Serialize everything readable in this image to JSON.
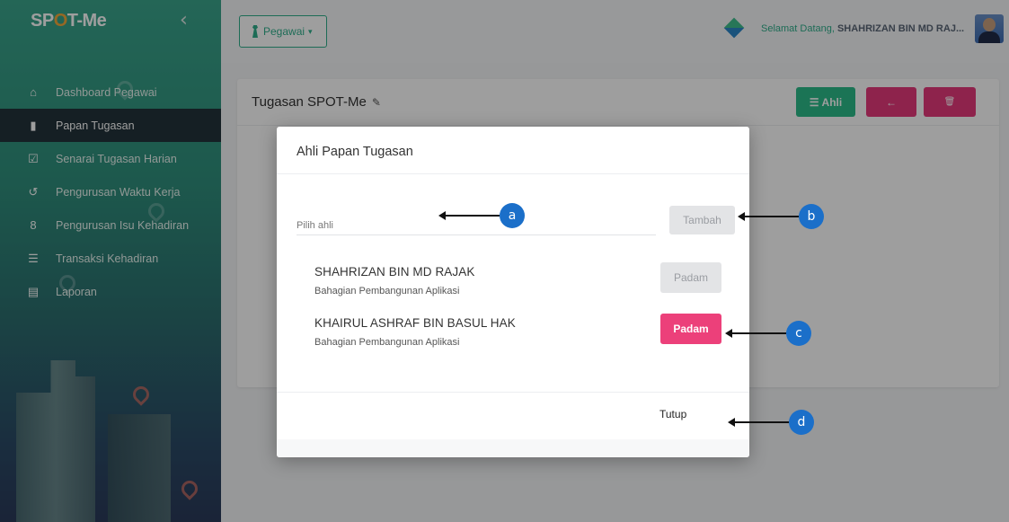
{
  "app": {
    "brand_prefix": "SP",
    "brand_o": "O",
    "brand_suffix": "T-Me"
  },
  "sidebar": {
    "items": [
      {
        "label": "Dashboard Pegawai",
        "icon": "home-icon"
      },
      {
        "label": "Papan Tugasan",
        "icon": "board-icon",
        "active": true
      },
      {
        "label": "Senarai Tugasan Harian",
        "icon": "checklist-icon"
      },
      {
        "label": "Pengurusan Waktu Kerja",
        "icon": "clock-history-icon"
      },
      {
        "label": "Pengurusan Isu Kehadiran",
        "icon": "person-badge-icon"
      },
      {
        "label": "Transaksi Kehadiran",
        "icon": "list-icon"
      },
      {
        "label": "Laporan",
        "icon": "report-icon"
      }
    ]
  },
  "topbar": {
    "role_label": "Pegawai",
    "welcome_text": "Selamat Datang,",
    "user_name": "SHAHRIZAN BIN MD RAJ..."
  },
  "card": {
    "title": "Tugasan SPOT-Me",
    "ahli_label": "Ahli",
    "back_label": "←",
    "delete_label": "🗑"
  },
  "modal": {
    "title": "Ahli Papan Tugasan",
    "picker_placeholder": "Pilih ahli",
    "add_label": "Tambah",
    "members": [
      {
        "name": "SHAHRIZAN BIN MD RAJAK",
        "dept": "Bahagian Pembangunan Aplikasi",
        "remove_label": "Padam"
      },
      {
        "name": "KHAIRUL ASHRAF BIN BASUL HAK",
        "dept": "Bahagian Pembangunan Aplikasi",
        "remove_label": "Padam"
      }
    ],
    "close_label": "Tutup"
  },
  "annotations": [
    "a",
    "b",
    "c",
    "d"
  ],
  "colors": {
    "accent": "#2fae8b",
    "danger": "#ec407a",
    "marker": "#1b6fc9"
  }
}
